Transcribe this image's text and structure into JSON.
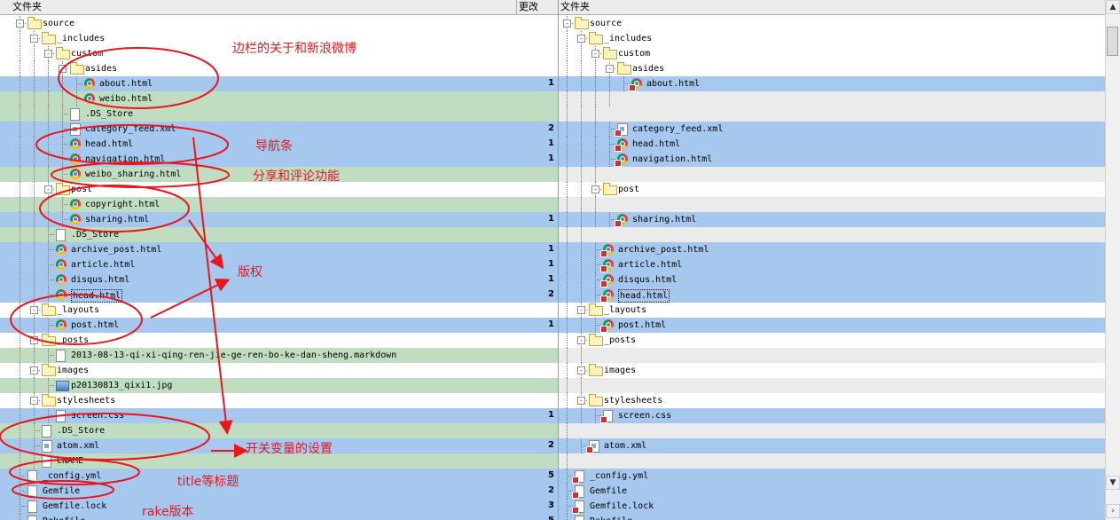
{
  "left": {
    "header": {
      "folder": "文件夹",
      "changes": "更改"
    },
    "rows": [
      {
        "d": 0,
        "t": "folder",
        "n": "source",
        "bg": "w",
        "c": "",
        "tog": "-"
      },
      {
        "d": 1,
        "t": "folder",
        "n": "_includes",
        "bg": "w",
        "c": "",
        "tog": "-"
      },
      {
        "d": 2,
        "t": "folder",
        "n": "custom",
        "bg": "w",
        "c": "",
        "tog": "-"
      },
      {
        "d": 3,
        "t": "folder",
        "n": "asides",
        "bg": "w",
        "c": "",
        "tog": "-"
      },
      {
        "d": 4,
        "t": "chrome",
        "n": "about.html",
        "bg": "b",
        "c": "1"
      },
      {
        "d": 4,
        "t": "chrome",
        "n": "weibo.html",
        "bg": "g",
        "c": ""
      },
      {
        "d": 3,
        "t": "file",
        "n": ".DS_Store",
        "bg": "g",
        "c": ""
      },
      {
        "d": 3,
        "t": "xml",
        "n": "category_feed.xml",
        "bg": "b",
        "c": "2"
      },
      {
        "d": 3,
        "t": "chrome",
        "n": "head.html",
        "bg": "b",
        "c": "1"
      },
      {
        "d": 3,
        "t": "chrome",
        "n": "navigation.html",
        "bg": "b",
        "c": "1"
      },
      {
        "d": 3,
        "t": "chrome",
        "n": "weibo_sharing.html",
        "bg": "g",
        "c": ""
      },
      {
        "d": 2,
        "t": "folder",
        "n": "post",
        "bg": "w",
        "c": "",
        "tog": "-"
      },
      {
        "d": 3,
        "t": "chrome",
        "n": "copyright.html",
        "bg": "g",
        "c": ""
      },
      {
        "d": 3,
        "t": "chrome",
        "n": "sharing.html",
        "bg": "b",
        "c": "1"
      },
      {
        "d": 2,
        "t": "file",
        "n": ".DS_Store",
        "bg": "g",
        "c": ""
      },
      {
        "d": 2,
        "t": "chrome",
        "n": "archive_post.html",
        "bg": "b",
        "c": "1"
      },
      {
        "d": 2,
        "t": "chrome",
        "n": "article.html",
        "bg": "b",
        "c": "1"
      },
      {
        "d": 2,
        "t": "chrome",
        "n": "disqus.html",
        "bg": "b",
        "c": "1"
      },
      {
        "d": 2,
        "t": "chrome",
        "n": "head.html",
        "bg": "b",
        "c": "2",
        "sel": true
      },
      {
        "d": 1,
        "t": "folder",
        "n": "_layouts",
        "bg": "w",
        "c": "",
        "tog": "-"
      },
      {
        "d": 2,
        "t": "chrome",
        "n": "post.html",
        "bg": "b",
        "c": "1"
      },
      {
        "d": 1,
        "t": "folder",
        "n": "_posts",
        "bg": "w",
        "c": "",
        "tog": "-"
      },
      {
        "d": 2,
        "t": "file",
        "n": "2013-08-13-qi-xi-qing-ren-jie-ge-ren-bo-ke-dan-sheng.markdown",
        "bg": "g",
        "c": ""
      },
      {
        "d": 1,
        "t": "folder",
        "n": "images",
        "bg": "w",
        "c": "",
        "tog": "-"
      },
      {
        "d": 2,
        "t": "img",
        "n": "p20130813_qixi1.jpg",
        "bg": "g",
        "c": ""
      },
      {
        "d": 1,
        "t": "folder",
        "n": "stylesheets",
        "bg": "w",
        "c": "",
        "tog": "-"
      },
      {
        "d": 2,
        "t": "file",
        "n": "screen.css",
        "bg": "b",
        "c": "1"
      },
      {
        "d": 1,
        "t": "file",
        "n": ".DS_Store",
        "bg": "g",
        "c": ""
      },
      {
        "d": 1,
        "t": "xml",
        "n": "atom.xml",
        "bg": "b",
        "c": "2"
      },
      {
        "d": 1,
        "t": "file",
        "n": "CNAME",
        "bg": "g",
        "c": ""
      },
      {
        "d": 0,
        "t": "file",
        "n": "_config.yml",
        "bg": "b",
        "c": "5"
      },
      {
        "d": 0,
        "t": "file",
        "n": "Gemfile",
        "bg": "b",
        "c": "2"
      },
      {
        "d": 0,
        "t": "file",
        "n": "Gemfile.lock",
        "bg": "b",
        "c": "3"
      },
      {
        "d": 0,
        "t": "file",
        "n": "Rakefile",
        "bg": "b",
        "c": "5"
      }
    ]
  },
  "right": {
    "header": {
      "folder": "文件夹"
    },
    "rows": [
      {
        "d": 0,
        "t": "folder",
        "n": "source",
        "bg": "w",
        "tog": "-"
      },
      {
        "d": 1,
        "t": "folder",
        "n": "_includes",
        "bg": "w",
        "tog": "-"
      },
      {
        "d": 2,
        "t": "folder",
        "n": "custom",
        "bg": "w",
        "tog": "-"
      },
      {
        "d": 3,
        "t": "folder",
        "n": "asides",
        "bg": "w",
        "tog": "-"
      },
      {
        "d": 4,
        "t": "chrome",
        "n": "about.html",
        "bg": "b",
        "m": true
      },
      {
        "d": 4,
        "t": "none",
        "n": "",
        "bg": "e"
      },
      {
        "d": 3,
        "t": "none",
        "n": "",
        "bg": "e"
      },
      {
        "d": 3,
        "t": "xml",
        "n": "category_feed.xml",
        "bg": "b",
        "m": true
      },
      {
        "d": 3,
        "t": "chrome",
        "n": "head.html",
        "bg": "b",
        "m": true
      },
      {
        "d": 3,
        "t": "chrome",
        "n": "navigation.html",
        "bg": "b",
        "m": true
      },
      {
        "d": 3,
        "t": "none",
        "n": "",
        "bg": "e"
      },
      {
        "d": 2,
        "t": "folder",
        "n": "post",
        "bg": "w",
        "tog": "-"
      },
      {
        "d": 3,
        "t": "none",
        "n": "",
        "bg": "e"
      },
      {
        "d": 3,
        "t": "chrome",
        "n": "sharing.html",
        "bg": "b",
        "m": true
      },
      {
        "d": 2,
        "t": "none",
        "n": "",
        "bg": "e"
      },
      {
        "d": 2,
        "t": "chrome",
        "n": "archive_post.html",
        "bg": "b",
        "m": true
      },
      {
        "d": 2,
        "t": "chrome",
        "n": "article.html",
        "bg": "b",
        "m": true
      },
      {
        "d": 2,
        "t": "chrome",
        "n": "disqus.html",
        "bg": "b",
        "m": true
      },
      {
        "d": 2,
        "t": "chrome",
        "n": "head.html",
        "bg": "b",
        "m": true,
        "sel": true
      },
      {
        "d": 1,
        "t": "folder",
        "n": "_layouts",
        "bg": "w",
        "tog": "-"
      },
      {
        "d": 2,
        "t": "chrome",
        "n": "post.html",
        "bg": "b",
        "m": true
      },
      {
        "d": 1,
        "t": "folder",
        "n": "_posts",
        "bg": "w",
        "tog": "-"
      },
      {
        "d": 2,
        "t": "none",
        "n": "",
        "bg": "e"
      },
      {
        "d": 1,
        "t": "folder",
        "n": "images",
        "bg": "w",
        "tog": "-"
      },
      {
        "d": 2,
        "t": "none",
        "n": "",
        "bg": "e"
      },
      {
        "d": 1,
        "t": "folder",
        "n": "stylesheets",
        "bg": "w",
        "tog": "-"
      },
      {
        "d": 2,
        "t": "file",
        "n": "screen.css",
        "bg": "b",
        "m": true
      },
      {
        "d": 1,
        "t": "none",
        "n": "",
        "bg": "e"
      },
      {
        "d": 1,
        "t": "xml",
        "n": "atom.xml",
        "bg": "b",
        "m": true
      },
      {
        "d": 1,
        "t": "none",
        "n": "",
        "bg": "e"
      },
      {
        "d": 0,
        "t": "file",
        "n": "_config.yml",
        "bg": "b",
        "m": true
      },
      {
        "d": 0,
        "t": "file",
        "n": "Gemfile",
        "bg": "b",
        "m": true
      },
      {
        "d": 0,
        "t": "file",
        "n": "Gemfile.lock",
        "bg": "b",
        "m": true
      },
      {
        "d": 0,
        "t": "file",
        "n": "Rakefile",
        "bg": "b",
        "m": true
      }
    ]
  },
  "annotations": {
    "sidebar_about_weibo": "边栏的关于和新浪微博",
    "navigation": "导航条",
    "share_comment": "分享和评论功能",
    "copyright": "版权",
    "switch_variables": "开关变量的设置",
    "title_etc": "title等标题",
    "rake_version": "rake版本"
  },
  "colors": {
    "modified_row": "#a7c8ee",
    "only_left_row": "#c1ddc1",
    "empty_row": "#ebebeb",
    "annotation_red": "#e8161d"
  },
  "scrollbar": {
    "up_arrow": "▲",
    "down_arrow": "▼"
  }
}
